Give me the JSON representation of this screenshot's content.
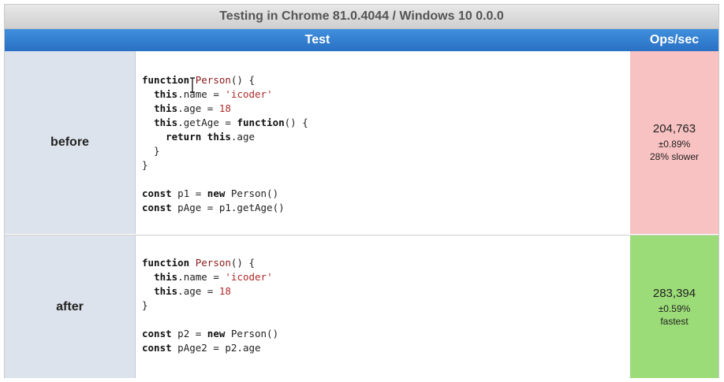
{
  "title": "Testing in Chrome 81.0.4044 / Windows 10 0.0.0",
  "headers": {
    "test": "Test",
    "ops": "Ops/sec"
  },
  "colors": {
    "slower": "#f9c2c2",
    "fastest": "#9cdc78",
    "header_blue": "#2a70c4"
  },
  "rows": [
    {
      "label": "before",
      "code": [
        "function Person() {",
        "  this.name = 'icoder'",
        "  this.age = 18",
        "  this.getAge = function() {",
        "    return this.age",
        "  }",
        "}",
        "",
        "const p1 = new Person()",
        "const pAge = p1.getAge()"
      ],
      "ops": "204,763",
      "margin": "±0.89%",
      "status": "28% slower"
    },
    {
      "label": "after",
      "code": [
        "function Person() {",
        "  this.name = 'icoder'",
        "  this.age = 18",
        "}",
        "",
        "const p2 = new Person()",
        "const pAge2 = p2.age"
      ],
      "ops": "283,394",
      "margin": "±0.59%",
      "status": "fastest"
    }
  ],
  "icons": {
    "cursor": "text-cursor-icon"
  }
}
